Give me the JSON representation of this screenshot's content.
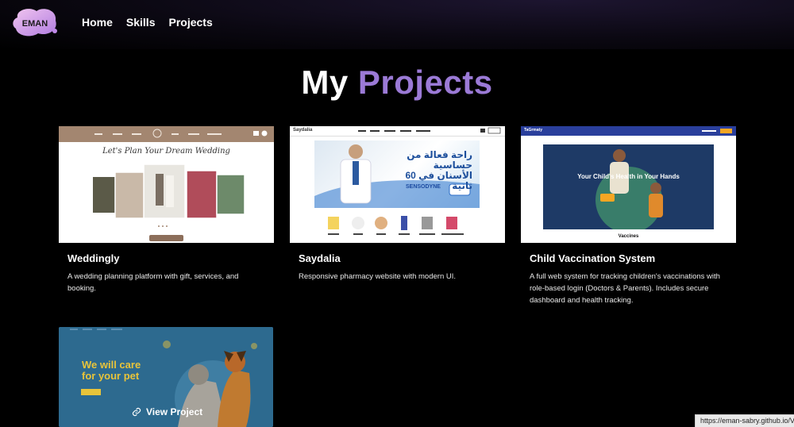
{
  "nav": {
    "home": "Home",
    "skills": "Skills",
    "projects": "Projects"
  },
  "logo": {
    "text": "EMAN"
  },
  "section": {
    "title_plain": "My",
    "title_accent": "Projects"
  },
  "projects": [
    {
      "title": "Weddingly",
      "description": "A wedding planning platform with gift, services, and booking.",
      "thumbnail_heading": "Let's Plan Your Dream Wedding"
    },
    {
      "title": "Saydalia",
      "description": "Responsive pharmacy website with modern UI.",
      "thumbnail_logo": "Saydalia",
      "thumbnail_arabic": "راحة فعالة من حساسية الأسنان في 60 ثانية",
      "thumbnail_brand": "SENSODYNE"
    },
    {
      "title": "Child Vaccination System",
      "description": "A full web system for tracking children's vaccinations with role-based login (Doctors & Parents). Includes secure dashboard and health tracking.",
      "thumbnail_brand": "TaGrmaty",
      "thumbnail_heading": "Your Child's Health in Your Hands",
      "thumbnail_footer": "Vaccines"
    },
    {
      "thumbnail_heading_line1": "We will care",
      "thumbnail_heading_line2": "for your pet",
      "hover_action": "View Project"
    }
  ],
  "status_bar": {
    "url": "https://eman-sabry.github.io/Ve"
  },
  "colors": {
    "accent": "#9b7ad6",
    "background": "#000000"
  }
}
